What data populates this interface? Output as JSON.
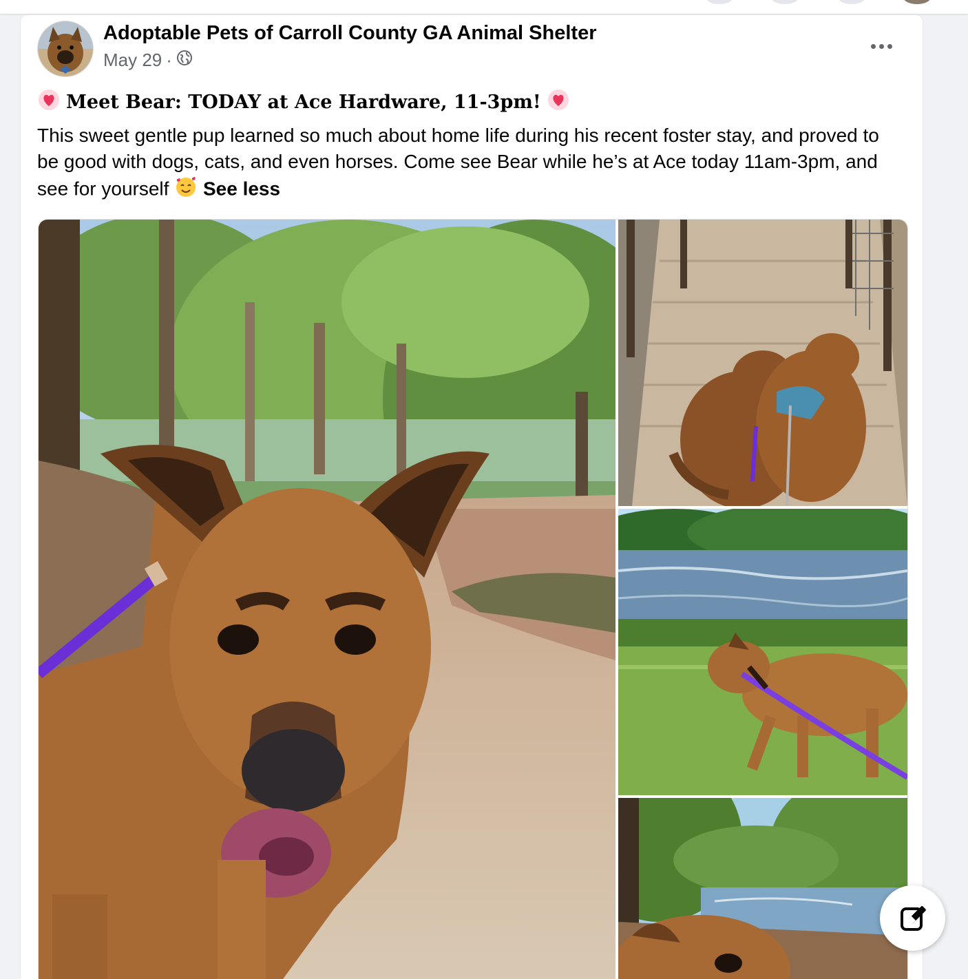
{
  "post": {
    "page_name": "Adoptable Pets of Carroll County GA Animal Shelter",
    "date": "May 29",
    "separator": "·",
    "privacy_icon": "globe-icon",
    "more_icon": "more-options-icon",
    "title": "Meet Bear: TODAY at Ace Hardware, 11-3pm!",
    "title_emoji": "heart-emoji",
    "body": "This sweet gentle pup learned so much about home life during his recent foster stay, and proved to be good with dogs, cats, and even horses. Come see Bear while he’s at Ace today 11am-3pm, and see for yourself",
    "body_emoji": "smiling-face-with-hearts-emoji",
    "see_less_label": "See less"
  },
  "photos": [
    {
      "subject": "bear-closeup-forest-trail"
    },
    {
      "subject": "two-dogs-on-bridge"
    },
    {
      "subject": "dog-walking-by-river"
    },
    {
      "subject": "dog-by-river-overlook"
    }
  ],
  "fab": {
    "icon": "compose-edit-icon"
  },
  "colors": {
    "text_primary": "#050505",
    "text_secondary": "#65676b",
    "background": "#f0f2f5",
    "card": "#ffffff",
    "leash_purple": "#6a2fd6"
  }
}
